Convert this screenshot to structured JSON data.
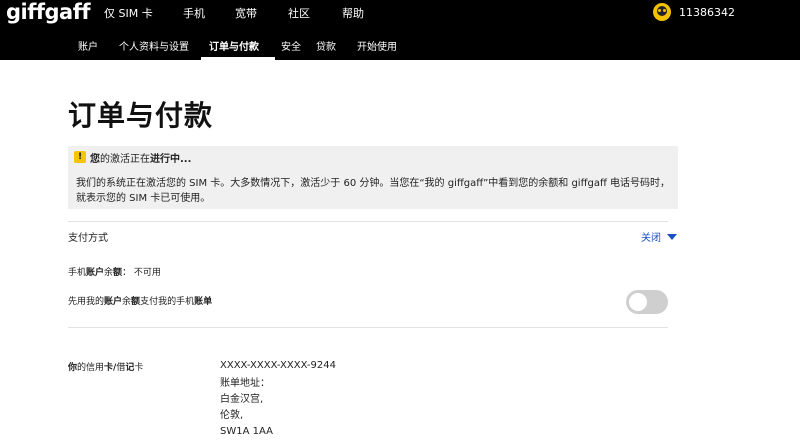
{
  "brand": {
    "logo": "giffgaff"
  },
  "main_nav": {
    "items": [
      "仅 SIM 卡",
      "手机",
      "宽带",
      "社区",
      "帮助"
    ]
  },
  "user": {
    "number": "11386342"
  },
  "sub_nav": {
    "items": [
      "账户",
      "个人资料与设置",
      "订单与付款",
      "安全",
      "贷款",
      "开始使用"
    ],
    "active": "订单与付款"
  },
  "page": {
    "title": "订单与付款"
  },
  "notice": {
    "heading_bold_1": "您",
    "heading_part_1": "的激活正在",
    "heading_bold_2": "进行中...",
    "body": "我们的系统正在激活您的 SIM 卡。大多数情况下，激活少于 60 分钟。当您在“我的 giffgaff”中看到您的余额和 giffgaff 电话号码时，就表示您的 SIM 卡已可使用。"
  },
  "payment": {
    "label": "支付方式",
    "close_label": "关闭",
    "balance_prefix": "手机",
    "balance_bold": "账户",
    "balance_middle": "余",
    "balance_bold_2": "额",
    "balance_suffix": "： 不可用",
    "use_balance_prefix": "先用我的",
    "use_balance_bold": "账户",
    "use_balance_middle": "余",
    "use_balance_bold_2": "额",
    "use_balance_mid2": "支付我的手机",
    "use_balance_bold_3": "账单",
    "toggle_on": false
  },
  "card": {
    "label_bold_1": "你",
    "label_middle": "的信用",
    "label_bold_2": "卡/",
    "label_middle_2": "借",
    "label_bold_3": "记",
    "label_suffix": "卡",
    "number": "XXXX-XXXX-XXXX-9244",
    "lines": [
      "账单地址：",
      "白金汉宫,",
      "伦敦,",
      "SW1A 1AA"
    ]
  },
  "colors": {
    "topbar": "#000000",
    "accent_link": "#1a4fc4",
    "warning": "#f7c400",
    "notice_bg": "#f0f0f0"
  }
}
